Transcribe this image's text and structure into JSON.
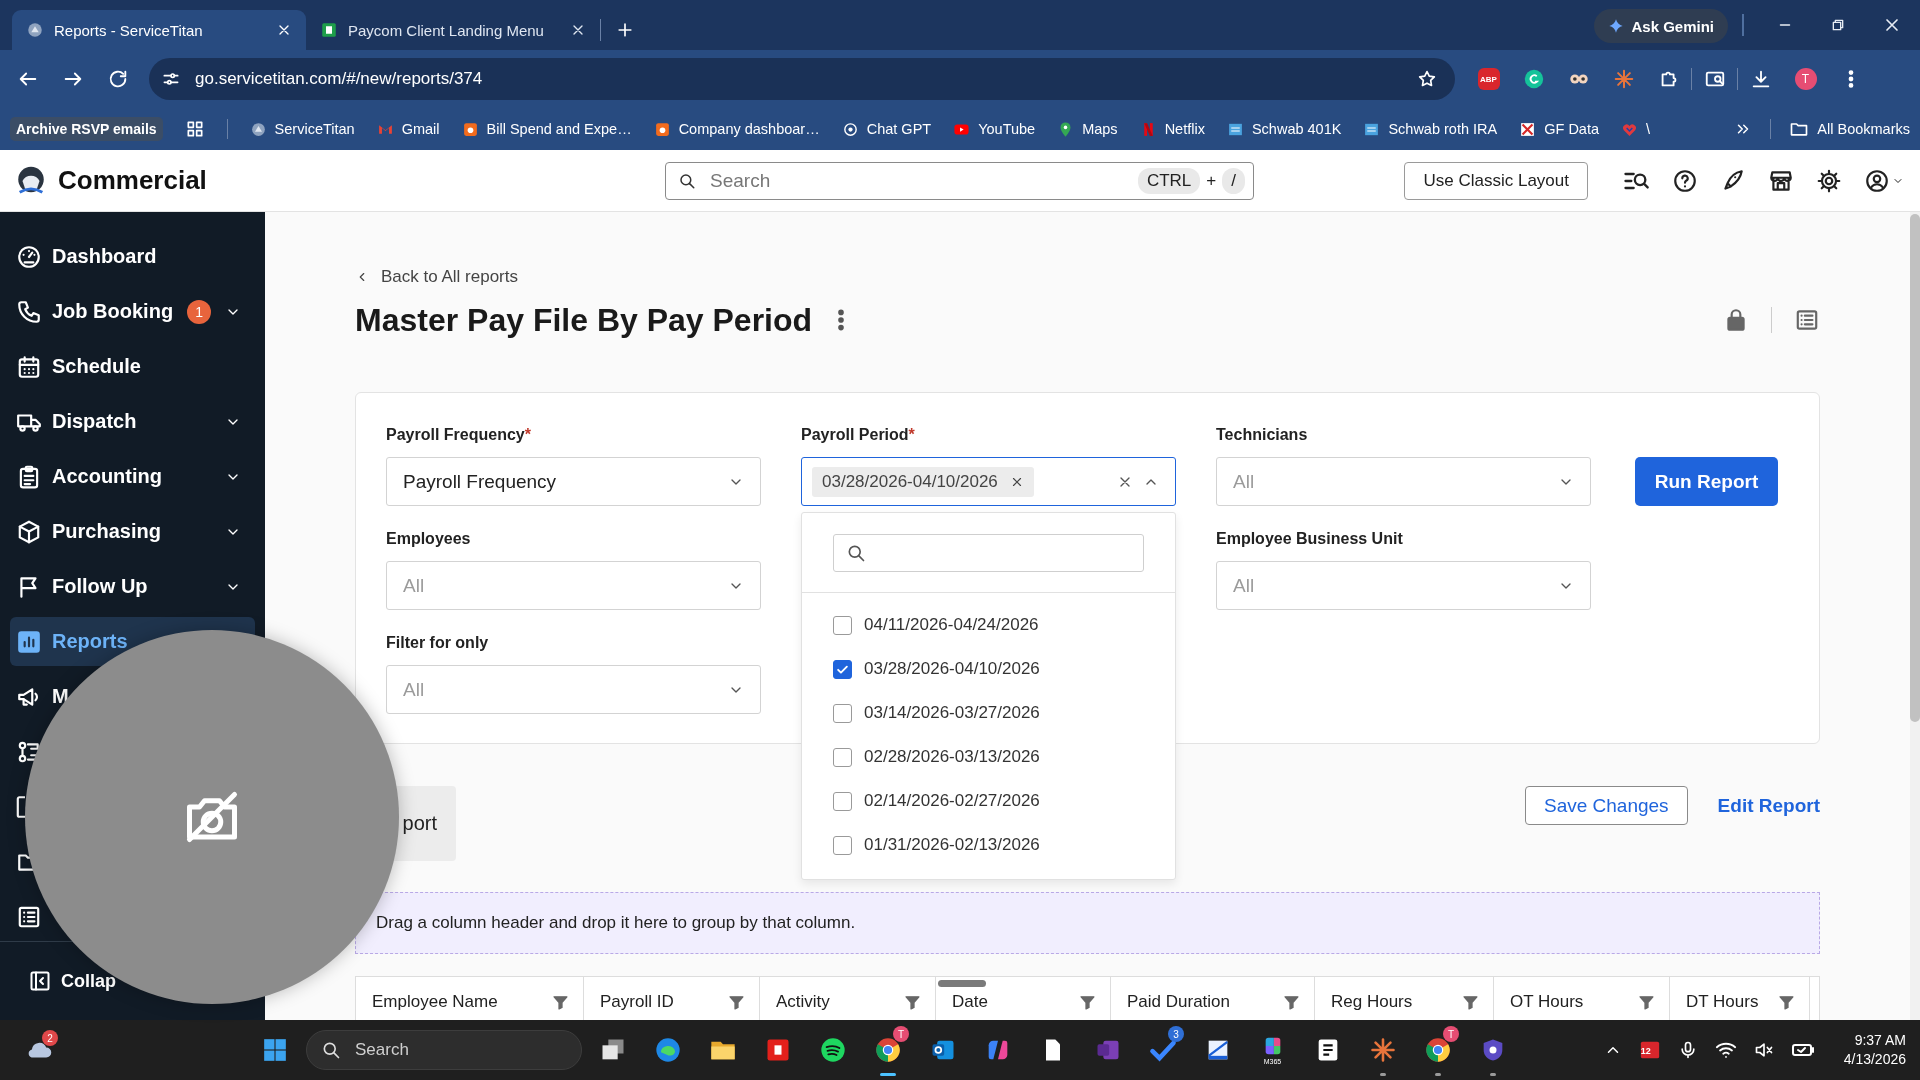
{
  "browser": {
    "tabs": [
      {
        "title": "Reports - ServiceTitan",
        "kind": "titan",
        "selected": true
      },
      {
        "title": "Paycom Client Landing Menu",
        "kind": "paycom",
        "selected": false
      }
    ],
    "gemini_button": "Ask Gemini",
    "url": "go.servicetitan.com/#/new/reports/374",
    "extensions": [
      {
        "kind": "abp",
        "label": "ABP"
      },
      {
        "kind": "grammar"
      },
      {
        "kind": "owl"
      },
      {
        "kind": "burst"
      },
      {
        "kind": "puzzle"
      },
      {
        "kind": "sidepanel"
      },
      {
        "kind": "download"
      }
    ],
    "profile_initial": "T",
    "bookmarks": [
      {
        "kind": "chip",
        "label": "Archive RSVP emails"
      },
      {
        "kind": "apps"
      },
      {
        "kind": "titan",
        "label": "ServiceTitan"
      },
      {
        "kind": "gmail",
        "label": "Gmail"
      },
      {
        "kind": "orange",
        "label": "Bill Spend and Expe…"
      },
      {
        "kind": "orange",
        "label": "Company dashboar…"
      },
      {
        "kind": "knot",
        "label": "Chat GPT"
      },
      {
        "kind": "youtube",
        "label": "YouTube"
      },
      {
        "kind": "maps",
        "label": "Maps"
      },
      {
        "kind": "netflix",
        "label": "Netflix"
      },
      {
        "kind": "schwab",
        "label": "Schwab 401K"
      },
      {
        "kind": "schwab",
        "label": "Schwab roth IRA"
      },
      {
        "kind": "gfdata",
        "label": "GF Data"
      },
      {
        "kind": "heart",
        "label": "\\"
      }
    ],
    "all_bookmarks": "All Bookmarks"
  },
  "app_header": {
    "brand": "Commercial",
    "search": {
      "placeholder": "Search",
      "keys": [
        {
          "label": "CTRL",
          "kind": "key"
        },
        {
          "label": "+",
          "kind": "plain"
        },
        {
          "label": "/",
          "kind": "key"
        }
      ]
    },
    "classic_button": "Use Classic Layout"
  },
  "sidebar": {
    "items": [
      {
        "label": "Dashboard",
        "kind": "gauge",
        "selected": false,
        "expandable": false
      },
      {
        "label": "Job Booking",
        "kind": "phone",
        "badge": "1",
        "selected": false,
        "expandable": true
      },
      {
        "label": "Schedule",
        "kind": "calendar",
        "selected": false,
        "expandable": false
      },
      {
        "label": "Dispatch",
        "kind": "truck",
        "selected": false,
        "expandable": true
      },
      {
        "label": "Accounting",
        "kind": "clipboard",
        "selected": false,
        "expandable": true
      },
      {
        "label": "Purchasing",
        "kind": "box",
        "selected": false,
        "expandable": true
      },
      {
        "label": "Follow Up",
        "kind": "flag",
        "selected": false,
        "expandable": true
      },
      {
        "label": "Reports",
        "kind": "bars",
        "selected": true,
        "expandable": false
      },
      {
        "label": "M",
        "kind": "megaphone",
        "selected": false
      },
      {
        "kind": "orgchart",
        "selected": false
      },
      {
        "kind": "device",
        "selected": false
      },
      {
        "kind": "folder",
        "selected": false
      },
      {
        "kind": "listbox",
        "selected": false
      }
    ],
    "collapse": "Collap"
  },
  "page": {
    "back_link": "Back to All reports",
    "title": "Master Pay File By Pay Period",
    "filters": {
      "columns": [
        [
          {
            "label": "Payroll Frequency",
            "required_mark": "*",
            "value": "Payroll Frequency"
          },
          {
            "label": "Employees",
            "placeholder": "All"
          },
          {
            "label": "Filter for only",
            "placeholder": "All"
          }
        ],
        [
          {
            "label": "Payroll Period",
            "required_mark": "*",
            "kind": "multi",
            "tags": [
              "03/28/2026-04/10/2026"
            ],
            "open": true,
            "options": [
              {
                "label": "04/11/2026-04/24/2026",
                "checked": false
              },
              {
                "label": "03/28/2026-04/10/2026",
                "checked": true
              },
              {
                "label": "03/14/2026-03/27/2026",
                "checked": false
              },
              {
                "label": "02/28/2026-03/13/2026",
                "checked": false
              },
              {
                "label": "02/14/2026-02/27/2026",
                "checked": false
              },
              {
                "label": "01/31/2026-02/13/2026",
                "checked": false
              }
            ]
          }
        ],
        [
          {
            "label": "Technicians",
            "placeholder": "All"
          },
          {
            "label": "Employee Business Unit",
            "placeholder": "All"
          }
        ]
      ],
      "run_button": "Run Report"
    },
    "partial_button": "port",
    "save_button": "Save Changes",
    "edit_link": "Edit Report",
    "group_panel": "Drag a column header and drop it here to group by that column.",
    "columns": [
      {
        "title": "Employee Name",
        "dragging": false
      },
      {
        "title": "Payroll ID",
        "dragging": false
      },
      {
        "title": "Activity",
        "dragging": false
      },
      {
        "title": "Date",
        "dragging": true
      },
      {
        "title": "Paid Duration",
        "dragging": false
      },
      {
        "title": "Reg Hours",
        "dragging": false
      },
      {
        "title": "OT Hours",
        "dragging": false
      },
      {
        "title": "DT Hours",
        "dragging": false
      }
    ]
  },
  "taskbar": {
    "weather_badge": "2",
    "search": {
      "placeholder": "Search"
    },
    "apps": [
      {
        "kind": "taskview",
        "running": false,
        "active": false
      },
      {
        "kind": "edge",
        "running": false,
        "active": false
      },
      {
        "kind": "folder",
        "running": false,
        "active": false
      },
      {
        "kind": "redapp",
        "running": false,
        "active": false
      },
      {
        "kind": "spotify",
        "running": false,
        "active": false
      },
      {
        "kind": "chrome",
        "badge": "T",
        "running": true,
        "active": true
      },
      {
        "kind": "outlook",
        "running": false,
        "active": false
      },
      {
        "kind": "copilot",
        "running": false,
        "active": false
      },
      {
        "kind": "file",
        "running": false,
        "active": false
      },
      {
        "kind": "onenote",
        "running": false,
        "active": false
      },
      {
        "kind": "todo",
        "badge": "3",
        "running": false,
        "active": false
      },
      {
        "kind": "pen",
        "running": false,
        "active": false
      },
      {
        "kind": "m365",
        "label": "M365",
        "running": false,
        "active": false
      },
      {
        "kind": "notion",
        "running": false,
        "active": false
      },
      {
        "kind": "burst",
        "running": true,
        "active": false
      },
      {
        "kind": "chrome",
        "badge": "T",
        "running": true,
        "active": false
      },
      {
        "kind": "shield",
        "running": true,
        "active": false
      }
    ],
    "calendar_badge": "12",
    "time": "9:37 AM",
    "date": "4/13/2026"
  }
}
